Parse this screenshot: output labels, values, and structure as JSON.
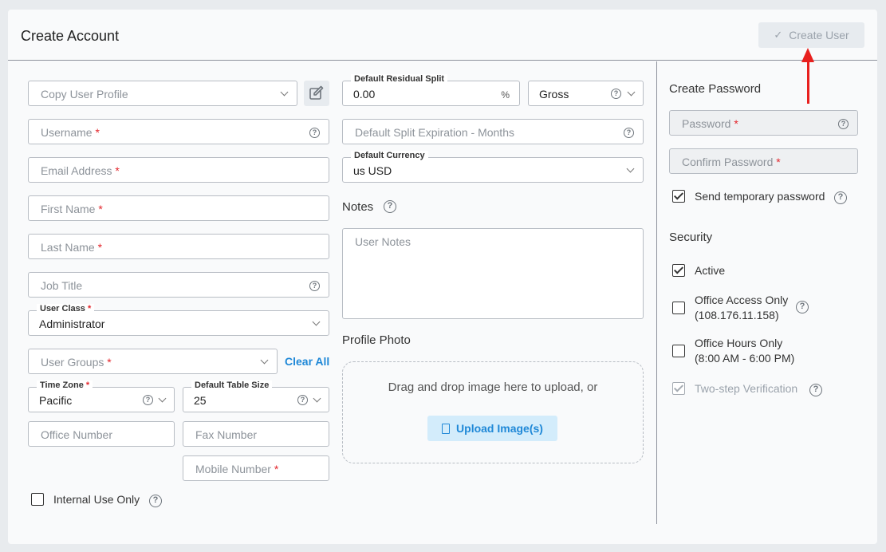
{
  "header": {
    "title": "Create Account",
    "create_button": "Create User"
  },
  "left": {
    "copy_profile": {
      "placeholder": "Copy User Profile"
    },
    "username": {
      "placeholder": "Username",
      "required": "*"
    },
    "email": {
      "placeholder": "Email Address",
      "required": "*"
    },
    "first_name": {
      "placeholder": "First Name",
      "required": "*"
    },
    "last_name": {
      "placeholder": "Last Name",
      "required": "*"
    },
    "job_title": {
      "placeholder": "Job Title"
    },
    "user_class": {
      "label": "User Class",
      "required": "*",
      "value": "Administrator"
    },
    "user_groups": {
      "placeholder": "User Groups",
      "required": "*",
      "clear_all": "Clear All"
    },
    "time_zone": {
      "label": "Time Zone",
      "required": "*",
      "value": "Pacific"
    },
    "table_size": {
      "label": "Default Table Size",
      "value": "25"
    },
    "office_number": {
      "placeholder": "Office Number"
    },
    "fax_number": {
      "placeholder": "Fax Number"
    },
    "mobile_number": {
      "placeholder": "Mobile Number",
      "required": "*"
    },
    "internal_use": {
      "label": "Internal Use Only",
      "checked": false
    }
  },
  "middle": {
    "residual_split": {
      "label": "Default Residual Split",
      "value": "0.00",
      "unit": "%"
    },
    "split_basis": {
      "value": "Gross"
    },
    "split_expiration": {
      "placeholder": "Default Split Expiration - Months"
    },
    "currency": {
      "label": "Default Currency",
      "value": "us USD"
    },
    "notes": {
      "heading": "Notes",
      "placeholder": "User Notes"
    },
    "profile_photo": {
      "heading": "Profile Photo",
      "drop_text": "Drag and drop image here to upload, or",
      "upload_button": "Upload Image(s)"
    }
  },
  "right": {
    "password_heading": "Create Password",
    "password": {
      "placeholder": "Password",
      "required": "*"
    },
    "confirm_password": {
      "placeholder": "Confirm Password",
      "required": "*"
    },
    "send_temp": {
      "label": "Send temporary password",
      "checked": true
    },
    "security_heading": "Security",
    "active": {
      "label": "Active",
      "checked": true
    },
    "office_access": {
      "label": "Office Access Only",
      "detail": "(108.176.11.158)",
      "checked": false
    },
    "office_hours": {
      "label": "Office Hours Only",
      "detail": "(8:00 AM - 6:00 PM)",
      "checked": false
    },
    "two_step": {
      "label": "Two-step Verification",
      "checked": true,
      "disabled": true
    }
  },
  "colors": {
    "accent": "#1f88d7",
    "required": "#e3262c",
    "annotation_arrow": "#e8201e"
  },
  "icons": {
    "help": "?",
    "check": "✓",
    "chevron": "chevron-down-icon",
    "edit": "pencil-square-icon",
    "file": "file-icon"
  }
}
